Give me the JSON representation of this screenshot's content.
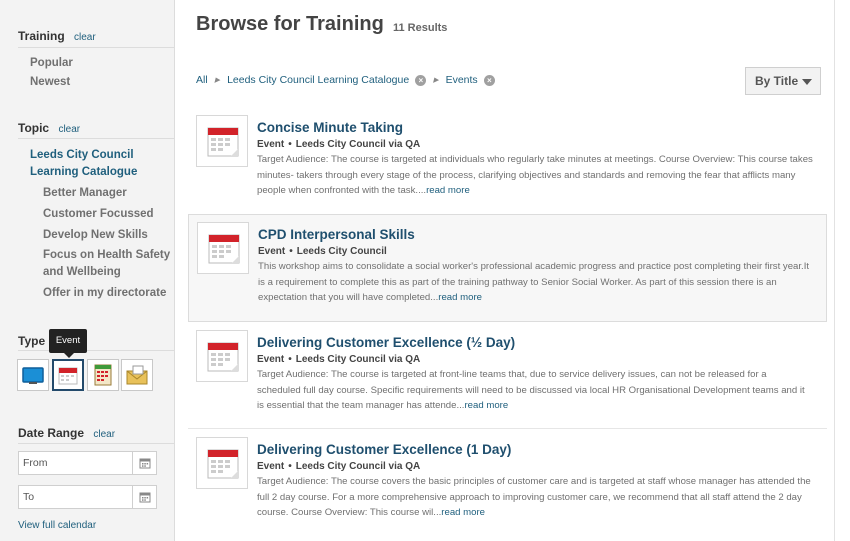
{
  "sidebar": {
    "training": {
      "heading": "Training",
      "clear": "clear",
      "items": [
        "Popular",
        "Newest"
      ]
    },
    "topic": {
      "heading": "Topic",
      "clear": "clear",
      "active": "Leeds City Council Learning Catalogue",
      "items": [
        "Better Manager",
        "Customer Focussed",
        "Develop New Skills",
        "Focus on Health Safety and Wellbeing",
        "Offer in my directorate"
      ]
    },
    "type": {
      "heading": "Type",
      "tooltip": "Event",
      "buttons": [
        "computer-icon",
        "event-calendar-icon",
        "schedule-icon",
        "mail-icon"
      ],
      "selected": "Event"
    },
    "date_range": {
      "heading": "Date Range",
      "clear": "clear",
      "from_placeholder": "From",
      "to_placeholder": "To",
      "calendar_link": "View full calendar"
    }
  },
  "main": {
    "title": "Browse for Training",
    "count": "11 Results",
    "breadcrumb": {
      "all": "All",
      "catalogue": "Leeds City Council Learning Catalogue",
      "events": "Events"
    },
    "sort_label": "By Title",
    "results": [
      {
        "title": "Concise Minute Taking",
        "type": "Event",
        "provider": "Leeds City Council via QA",
        "description": "Target Audience: The course is targeted at individuals who regularly take minutes at meetings. Course Overview: This course takes minutes- takers through every stage of the process, clarifying objectives and standards and removing the fear that afflicts many people when confronted with the task....",
        "more": "read more"
      },
      {
        "title": "CPD Interpersonal Skills",
        "type": "Event",
        "provider": "Leeds City Council",
        "description": "This workshop aims to consolidate a social worker's professional academic progress and practice post completing their first year.It is a requirement to complete this as part of the training pathway to Senior Social Worker. As part of this session there is an expectation that you will have completed...",
        "more": "read more"
      },
      {
        "title": "Delivering Customer Excellence (½ Day)",
        "type": "Event",
        "provider": "Leeds City Council via QA",
        "description": "Target Audience: The course is targeted at front-line teams that, due to service delivery issues, can not be released for a scheduled full day course. Specific requirements will need to be discussed via local HR Organisational Development teams and it is essential that the team manager has attende...",
        "more": "read more"
      },
      {
        "title": "Delivering Customer Excellence (1 Day)",
        "type": "Event",
        "provider": "Leeds City Council via QA",
        "description": "Target Audience: The course covers the basic principles of customer care and is targeted at staff whose manager has attended the full 2 day course. For a more comprehensive approach to improving customer care, we recommend that all staff attend the 2 day course. Course Overview: This course wil...",
        "more": "read more"
      }
    ]
  },
  "colors": {
    "link": "#1f5f7d",
    "title": "#1f4f6e",
    "calendar_red": "#d2232a"
  }
}
